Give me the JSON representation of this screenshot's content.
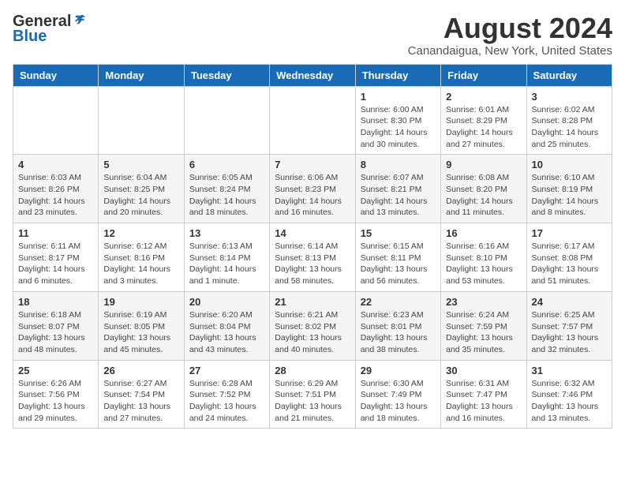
{
  "logo": {
    "general": "General",
    "blue": "Blue"
  },
  "title": "August 2024",
  "location": "Canandaigua, New York, United States",
  "days_of_week": [
    "Sunday",
    "Monday",
    "Tuesday",
    "Wednesday",
    "Thursday",
    "Friday",
    "Saturday"
  ],
  "weeks": [
    [
      {
        "day": "",
        "info": ""
      },
      {
        "day": "",
        "info": ""
      },
      {
        "day": "",
        "info": ""
      },
      {
        "day": "",
        "info": ""
      },
      {
        "day": "1",
        "info": "Sunrise: 6:00 AM\nSunset: 8:30 PM\nDaylight: 14 hours and 30 minutes."
      },
      {
        "day": "2",
        "info": "Sunrise: 6:01 AM\nSunset: 8:29 PM\nDaylight: 14 hours and 27 minutes."
      },
      {
        "day": "3",
        "info": "Sunrise: 6:02 AM\nSunset: 8:28 PM\nDaylight: 14 hours and 25 minutes."
      }
    ],
    [
      {
        "day": "4",
        "info": "Sunrise: 6:03 AM\nSunset: 8:26 PM\nDaylight: 14 hours and 23 minutes."
      },
      {
        "day": "5",
        "info": "Sunrise: 6:04 AM\nSunset: 8:25 PM\nDaylight: 14 hours and 20 minutes."
      },
      {
        "day": "6",
        "info": "Sunrise: 6:05 AM\nSunset: 8:24 PM\nDaylight: 14 hours and 18 minutes."
      },
      {
        "day": "7",
        "info": "Sunrise: 6:06 AM\nSunset: 8:23 PM\nDaylight: 14 hours and 16 minutes."
      },
      {
        "day": "8",
        "info": "Sunrise: 6:07 AM\nSunset: 8:21 PM\nDaylight: 14 hours and 13 minutes."
      },
      {
        "day": "9",
        "info": "Sunrise: 6:08 AM\nSunset: 8:20 PM\nDaylight: 14 hours and 11 minutes."
      },
      {
        "day": "10",
        "info": "Sunrise: 6:10 AM\nSunset: 8:19 PM\nDaylight: 14 hours and 8 minutes."
      }
    ],
    [
      {
        "day": "11",
        "info": "Sunrise: 6:11 AM\nSunset: 8:17 PM\nDaylight: 14 hours and 6 minutes."
      },
      {
        "day": "12",
        "info": "Sunrise: 6:12 AM\nSunset: 8:16 PM\nDaylight: 14 hours and 3 minutes."
      },
      {
        "day": "13",
        "info": "Sunrise: 6:13 AM\nSunset: 8:14 PM\nDaylight: 14 hours and 1 minute."
      },
      {
        "day": "14",
        "info": "Sunrise: 6:14 AM\nSunset: 8:13 PM\nDaylight: 13 hours and 58 minutes."
      },
      {
        "day": "15",
        "info": "Sunrise: 6:15 AM\nSunset: 8:11 PM\nDaylight: 13 hours and 56 minutes."
      },
      {
        "day": "16",
        "info": "Sunrise: 6:16 AM\nSunset: 8:10 PM\nDaylight: 13 hours and 53 minutes."
      },
      {
        "day": "17",
        "info": "Sunrise: 6:17 AM\nSunset: 8:08 PM\nDaylight: 13 hours and 51 minutes."
      }
    ],
    [
      {
        "day": "18",
        "info": "Sunrise: 6:18 AM\nSunset: 8:07 PM\nDaylight: 13 hours and 48 minutes."
      },
      {
        "day": "19",
        "info": "Sunrise: 6:19 AM\nSunset: 8:05 PM\nDaylight: 13 hours and 45 minutes."
      },
      {
        "day": "20",
        "info": "Sunrise: 6:20 AM\nSunset: 8:04 PM\nDaylight: 13 hours and 43 minutes."
      },
      {
        "day": "21",
        "info": "Sunrise: 6:21 AM\nSunset: 8:02 PM\nDaylight: 13 hours and 40 minutes."
      },
      {
        "day": "22",
        "info": "Sunrise: 6:23 AM\nSunset: 8:01 PM\nDaylight: 13 hours and 38 minutes."
      },
      {
        "day": "23",
        "info": "Sunrise: 6:24 AM\nSunset: 7:59 PM\nDaylight: 13 hours and 35 minutes."
      },
      {
        "day": "24",
        "info": "Sunrise: 6:25 AM\nSunset: 7:57 PM\nDaylight: 13 hours and 32 minutes."
      }
    ],
    [
      {
        "day": "25",
        "info": "Sunrise: 6:26 AM\nSunset: 7:56 PM\nDaylight: 13 hours and 29 minutes."
      },
      {
        "day": "26",
        "info": "Sunrise: 6:27 AM\nSunset: 7:54 PM\nDaylight: 13 hours and 27 minutes."
      },
      {
        "day": "27",
        "info": "Sunrise: 6:28 AM\nSunset: 7:52 PM\nDaylight: 13 hours and 24 minutes."
      },
      {
        "day": "28",
        "info": "Sunrise: 6:29 AM\nSunset: 7:51 PM\nDaylight: 13 hours and 21 minutes."
      },
      {
        "day": "29",
        "info": "Sunrise: 6:30 AM\nSunset: 7:49 PM\nDaylight: 13 hours and 18 minutes."
      },
      {
        "day": "30",
        "info": "Sunrise: 6:31 AM\nSunset: 7:47 PM\nDaylight: 13 hours and 16 minutes."
      },
      {
        "day": "31",
        "info": "Sunrise: 6:32 AM\nSunset: 7:46 PM\nDaylight: 13 hours and 13 minutes."
      }
    ]
  ]
}
